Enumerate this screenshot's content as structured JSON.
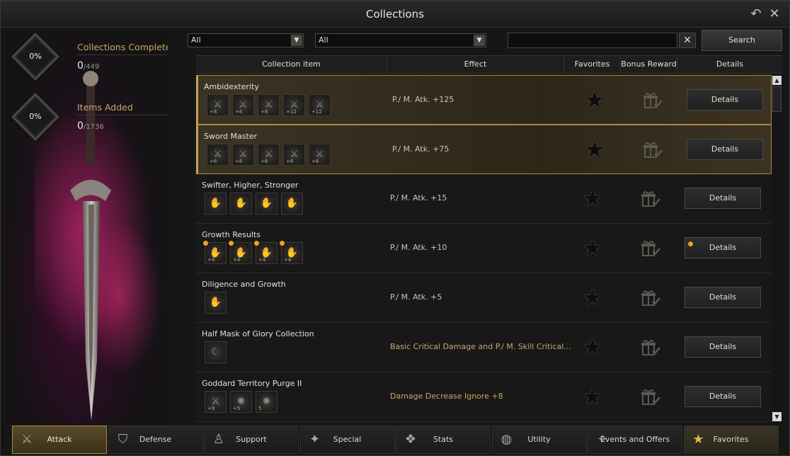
{
  "window": {
    "title": "Collections"
  },
  "stats": [
    {
      "percent": "0%",
      "label": "Collections Completed",
      "value": "0",
      "total": "/449"
    },
    {
      "percent": "0%",
      "label": "Items Added",
      "value": "0",
      "total": "/1736"
    }
  ],
  "filters": {
    "filter1": "All",
    "filter2": "All",
    "search_value": "",
    "clear_label": "✕",
    "search_label": "Search"
  },
  "columns": [
    "Collection item",
    "Effect",
    "Favorites",
    "Bonus Reward",
    "Details"
  ],
  "rows": [
    {
      "name": "Ambidexterity",
      "effect": "P./ M. Atk. +125",
      "highlight": true,
      "icons": [
        {
          "g": "⚔",
          "c": "+8"
        },
        {
          "g": "⚔",
          "c": "+6"
        },
        {
          "g": "⚔",
          "c": "+6"
        },
        {
          "g": "⚔",
          "c": "+12"
        },
        {
          "g": "⚔",
          "c": "+12"
        }
      ],
      "details": "Details"
    },
    {
      "name": "Sword Master",
      "effect": "P./ M. Atk. +75",
      "highlight": true,
      "icons": [
        {
          "g": "⚔",
          "c": "+6"
        },
        {
          "g": "⚔",
          "c": "+6"
        },
        {
          "g": "⚔",
          "c": "+6"
        },
        {
          "g": "⚔",
          "c": "+6"
        },
        {
          "g": "⚔",
          "c": "+6"
        }
      ],
      "details": "Details"
    },
    {
      "name": "Swifter, Higher, Stronger",
      "effect": "P./ M. Atk. +15",
      "highlight": false,
      "icons": [
        {
          "g": "✋",
          "c": ""
        },
        {
          "g": "✋",
          "c": ""
        },
        {
          "g": "✋",
          "c": ""
        },
        {
          "g": "✋",
          "c": ""
        }
      ],
      "details": "Details"
    },
    {
      "name": "Growth Results",
      "effect": "P./ M. Atk. +10",
      "highlight": false,
      "dotted": true,
      "icons": [
        {
          "g": "✋",
          "c": "+4"
        },
        {
          "g": "✋",
          "c": "+4"
        },
        {
          "g": "✋",
          "c": "+4"
        },
        {
          "g": "✋",
          "c": "+4"
        }
      ],
      "details": "Details"
    },
    {
      "name": "Diligence and Growth",
      "effect": "P./ M. Atk. +5",
      "highlight": false,
      "icons": [
        {
          "g": "✋",
          "c": ""
        }
      ],
      "details": "Details"
    },
    {
      "name": "Half Mask of Glory Collection",
      "effect": "Basic Critical Damage and P./ M. Skill Critical...",
      "highlight": false,
      "gold": true,
      "icons": [
        {
          "g": "☾",
          "c": ""
        }
      ],
      "details": "Details"
    },
    {
      "name": "Goddard Territory Purge II",
      "effect": "Damage Decrease Ignore +8",
      "highlight": false,
      "gold": true,
      "icons": [
        {
          "g": "⚔",
          "c": "+9"
        },
        {
          "g": "✺",
          "c": "+5"
        },
        {
          "g": "✺",
          "c": "5"
        }
      ],
      "details": "Details"
    }
  ],
  "tabs": [
    {
      "label": "Attack",
      "icon": "attack-icon",
      "glyph": "⚔"
    },
    {
      "label": "Defense",
      "icon": "shield-icon",
      "glyph": "⛉"
    },
    {
      "label": "Support",
      "icon": "support-icon",
      "glyph": "♙"
    },
    {
      "label": "Special",
      "icon": "sparkle-icon",
      "glyph": "✦"
    },
    {
      "label": "Stats",
      "icon": "stats-icon",
      "glyph": "❖"
    },
    {
      "label": "Utility",
      "icon": "globe-icon",
      "glyph": "◍"
    },
    {
      "label": "Events and Offers",
      "icon": "events-icon",
      "glyph": "✧"
    },
    {
      "label": "Favorites",
      "icon": "star-icon",
      "glyph": "★"
    }
  ],
  "colors": {
    "accent": "#c9a350",
    "gold_text": "#c9a869",
    "notice_dot": "#f0a020"
  }
}
